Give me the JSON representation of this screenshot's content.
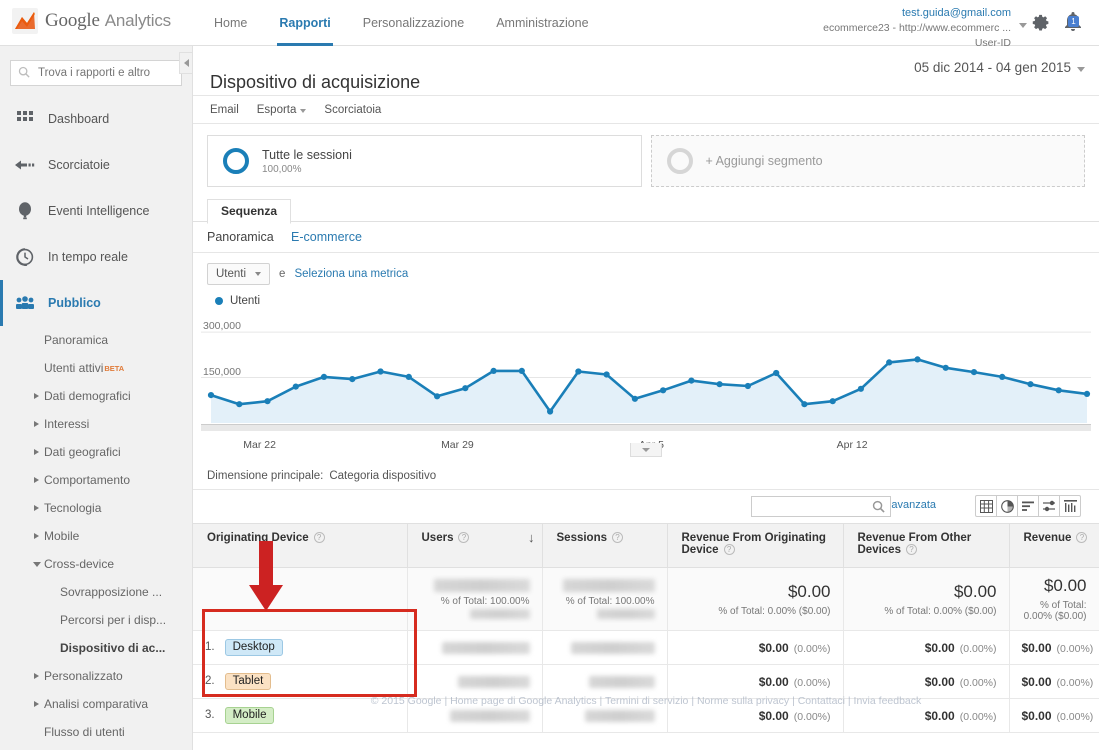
{
  "topbar": {
    "brand_google": "Google",
    "brand_product": "Analytics",
    "nav": [
      {
        "label": "Home",
        "active": false
      },
      {
        "label": "Rapporti",
        "active": true
      },
      {
        "label": "Personalizzazione",
        "active": false
      },
      {
        "label": "Amministrazione",
        "active": false
      }
    ],
    "account": {
      "email": "test.guida@gmail.com",
      "property": "ecommerce23 - http://www.ecommerc ...",
      "view": "User-ID"
    },
    "gear_icon": "gear-icon",
    "bell_icon": "bell-icon",
    "bell_badge": "1"
  },
  "sidebar": {
    "search_placeholder": "Trova i rapporti e altro",
    "search_icon": "search-icon",
    "main_items": [
      {
        "label": "Dashboard",
        "icon": "dashboard-grid-icon",
        "selected": false
      },
      {
        "label": "Scorciatoie",
        "icon": "shortcut-arrow-icon",
        "selected": false
      },
      {
        "label": "Eventi Intelligence",
        "icon": "intelligence-balloon-icon",
        "selected": false
      },
      {
        "label": "In tempo reale",
        "icon": "realtime-clock-icon",
        "selected": false
      },
      {
        "label": "Pubblico",
        "icon": "audience-people-icon",
        "selected": true
      }
    ],
    "sub_items": [
      {
        "label": "Panoramica",
        "level": 1,
        "expander": "none",
        "bold": false
      },
      {
        "label": "Utenti attivi",
        "level": 1,
        "expander": "none",
        "bold": false,
        "badge": "BETA"
      },
      {
        "label": "Dati demografici",
        "level": 1,
        "expander": "closed",
        "bold": false
      },
      {
        "label": "Interessi",
        "level": 1,
        "expander": "closed",
        "bold": false
      },
      {
        "label": "Dati geografici",
        "level": 1,
        "expander": "closed",
        "bold": false
      },
      {
        "label": "Comportamento",
        "level": 1,
        "expander": "closed",
        "bold": false
      },
      {
        "label": "Tecnologia",
        "level": 1,
        "expander": "closed",
        "bold": false
      },
      {
        "label": "Mobile",
        "level": 1,
        "expander": "closed",
        "bold": false
      },
      {
        "label": "Cross-device",
        "level": 1,
        "expander": "open",
        "bold": false
      },
      {
        "label": "Sovrapposizione ...",
        "level": 2,
        "expander": "none",
        "bold": false
      },
      {
        "label": "Percorsi per i disp...",
        "level": 2,
        "expander": "none",
        "bold": false
      },
      {
        "label": "Dispositivo di ac...",
        "level": 2,
        "expander": "none",
        "bold": true
      },
      {
        "label": "Personalizzato",
        "level": 1,
        "expander": "closed",
        "bold": false
      },
      {
        "label": "Analisi comparativa",
        "level": 1,
        "expander": "closed",
        "bold": false
      },
      {
        "label": "Flusso di utenti",
        "level": 1,
        "expander": "none",
        "bold": false
      }
    ]
  },
  "page": {
    "title": "Dispositivo di acquisizione",
    "date_range": "05 dic 2014 - 04 gen 2015",
    "actions": [
      {
        "label": "Email",
        "dropdown": false
      },
      {
        "label": "Esporta",
        "dropdown": true
      },
      {
        "label": "Scorciatoia",
        "dropdown": false
      }
    ]
  },
  "segments": [
    {
      "name": "Tutte le sessioni",
      "pct": "100,00%",
      "type": "active"
    },
    {
      "name": "+ Aggiungi segmento",
      "pct": "",
      "type": "add"
    }
  ],
  "tabs": {
    "primary": "Sequenza",
    "secondary": [
      {
        "label": "Panoramica",
        "current": true
      },
      {
        "label": "E-commerce",
        "current": false
      }
    ]
  },
  "metric_bar": {
    "selected_metric": "Utenti",
    "and": "e",
    "select_link": "Seleziona una metrica",
    "legend_label": "Utenti",
    "legend_color": "#1a7fb8"
  },
  "chart_data": {
    "type": "area",
    "title": "",
    "xlabel": "",
    "ylabel": "",
    "series": [
      {
        "name": "Utenti",
        "color": "#1a7fb8",
        "values": [
          92000,
          62000,
          72000,
          120000,
          152000,
          145000,
          170000,
          152000,
          88000,
          115000,
          172000,
          172000,
          38000,
          170000,
          160000,
          80000,
          108000,
          140000,
          128000,
          122000,
          165000,
          62000,
          72000,
          113000,
          200000,
          210000,
          182000,
          168000,
          152000,
          128000,
          108000,
          96000
        ]
      }
    ],
    "ytick_labels": [
      "150,000",
      "300,000"
    ],
    "ytick_values": [
      150000,
      300000
    ],
    "ylim": [
      0,
      330000
    ],
    "xtick_labels": [
      "Mar 22",
      "Mar 29",
      "Apr 5",
      "Apr 12"
    ],
    "xtick_indices": [
      1,
      8,
      15,
      22
    ],
    "grid": true,
    "legend_position": "top-left",
    "fill_color": "#e3f0f9"
  },
  "dimension_bar": {
    "label": "Dimensione principale:",
    "value": "Categoria dispositivo"
  },
  "table_toolbar": {
    "search_value": "",
    "advanced_link": "avanzata",
    "search_icon": "search-icon",
    "view_icons": [
      "table-view-icon",
      "pie-chart-view-icon",
      "performance-view-icon",
      "comparison-view-icon",
      "pivot-view-icon"
    ]
  },
  "table": {
    "columns": [
      {
        "label": "Originating Device",
        "align": "left",
        "help": true,
        "sorted": false
      },
      {
        "label": "Users",
        "align": "left",
        "help": true,
        "sorted": true,
        "sort_dir": "desc"
      },
      {
        "label": "Sessions",
        "align": "left",
        "help": true,
        "sorted": false
      },
      {
        "label": "Revenue From Originating Device",
        "align": "left",
        "help": true,
        "sorted": false
      },
      {
        "label": "Revenue From Other Devices",
        "align": "left",
        "help": true,
        "sorted": false
      },
      {
        "label": "Revenue",
        "align": "left",
        "help": true,
        "sorted": false
      }
    ],
    "summary_row": {
      "label": "",
      "users": {
        "value": "",
        "blurred": true,
        "pct_of_total": "% of Total: 100.00%"
      },
      "sessions": {
        "value": "",
        "blurred": true,
        "pct_of_total": "% of Total: 100.00%"
      },
      "rev_orig": {
        "value": "$0.00",
        "pct_of_total": "% of Total: 0.00% ($0.00)"
      },
      "rev_other": {
        "value": "$0.00",
        "pct_of_total": "% of Total: 0.00% ($0.00)"
      },
      "revenue": {
        "value": "$0.00",
        "pct_of_total": "% of Total: 0.00% ($0.00)"
      }
    },
    "rows": [
      {
        "index": "1.",
        "device": "Desktop",
        "device_style": "desktop",
        "users": {
          "blurred": true
        },
        "sessions": {
          "blurred": true
        },
        "rev_orig": "$0.00",
        "rev_orig_pct": "(0.00%)",
        "rev_other": "$0.00",
        "rev_other_pct": "(0.00%)",
        "revenue": "$0.00",
        "revenue_pct": "(0.00%)"
      },
      {
        "index": "2.",
        "device": "Tablet",
        "device_style": "tablet",
        "users": {
          "blurred": true
        },
        "sessions": {
          "blurred": true
        },
        "rev_orig": "$0.00",
        "rev_orig_pct": "(0.00%)",
        "rev_other": "$0.00",
        "rev_other_pct": "(0.00%)",
        "revenue": "$0.00",
        "revenue_pct": "(0.00%)"
      },
      {
        "index": "3.",
        "device": "Mobile",
        "device_style": "mobile",
        "users": {
          "blurred": true
        },
        "sessions": {
          "blurred": true
        },
        "rev_orig": "$0.00",
        "rev_orig_pct": "(0.00%)",
        "rev_other": "$0.00",
        "rev_other_pct": "(0.00%)",
        "revenue": "$0.00",
        "revenue_pct": "(0.00%)"
      }
    ]
  },
  "annotations": {
    "arrow_color": "#cc2222",
    "box_color": "#d62b1f"
  },
  "footer": "© 2015 Google | Home page di Google Analytics | Termini di servizio | Norme sulla privacy | Contattaci | Invia feedback"
}
